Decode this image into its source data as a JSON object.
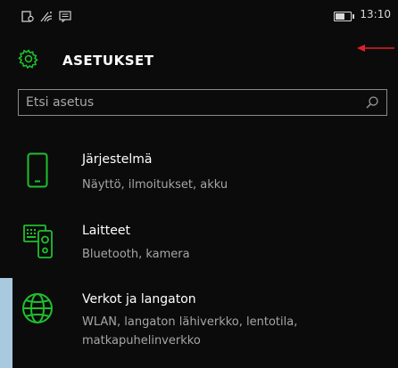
{
  "statusbar": {
    "time": "13:10",
    "icons": [
      "notification-icon",
      "signal-icon",
      "message-icon"
    ],
    "battery_level": 0.6
  },
  "header": {
    "title": "ASETUKSET",
    "icon": "gear-icon"
  },
  "search": {
    "placeholder": "Etsi asetus",
    "value": ""
  },
  "categories": [
    {
      "name": "Järjestelmä",
      "description": "Näyttö, ilmoitukset, akku",
      "icon": "phone-icon"
    },
    {
      "name": "Laitteet",
      "description": "Bluetooth, kamera",
      "icon": "devices-icon"
    },
    {
      "name": "Verkot ja langaton",
      "description": "WLAN, langaton lähiverkko, lentotila, matkapuhelinverkko",
      "icon": "globe-icon"
    }
  ],
  "colors": {
    "accent": "#1fbf2e",
    "background": "#0b0b0b",
    "annotation": "#e0202a"
  }
}
